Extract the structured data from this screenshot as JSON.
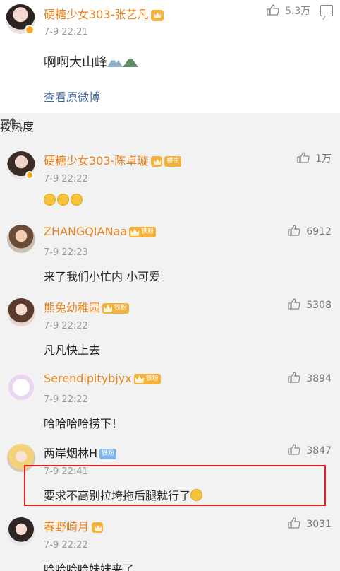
{
  "post": {
    "author": "硬糖少女303-张艺凡",
    "time": "7-9 22:21",
    "likes": "5.3万",
    "text": "啊啊大山峰",
    "view_original": "查看原微博"
  },
  "sort": {
    "label": "按热度"
  },
  "comments": [
    {
      "author": "硬糖少女303-陈卓璇",
      "badge": "楼主",
      "time": "7-9 22:22",
      "likes": "1万",
      "text": ""
    },
    {
      "author": "ZHANGQIANaa",
      "badge": "铁粉",
      "time": "7-9 22:23",
      "likes": "6912",
      "text": "来了我们小忙内 小可爱"
    },
    {
      "author": "熊兔幼稚园",
      "badge": "铁粉",
      "time": "7-9 22:22",
      "likes": "5308",
      "text": "凡凡快上去"
    },
    {
      "author": "Serendipitybjyx",
      "badge": "铁粉",
      "time": "7-9 22:22",
      "likes": "3894",
      "text": "哈哈哈哈捞下！"
    },
    {
      "author": "两岸烟林H",
      "badge": "铁粉",
      "time": "7-9 22:41",
      "likes": "3847",
      "text": "要求不高别拉垮拖后腿就行了"
    },
    {
      "author": "春野崎月",
      "badge": "",
      "time": "7-9 22:22",
      "likes": "3031",
      "text": "哈哈哈哈妹妹来了"
    }
  ],
  "colors": {
    "username": "#e8841c",
    "link": "#486b96",
    "highlight": "#e02020",
    "badge": "#f3b23c"
  }
}
